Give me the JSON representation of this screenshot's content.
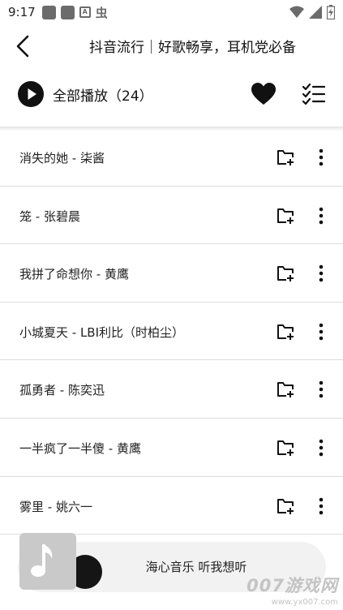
{
  "status_bar": {
    "time": "9:17",
    "icons": [
      "app-icon",
      "app-icon",
      "a-icon",
      "bug-icon",
      "wifi-icon",
      "signal-icon",
      "battery-icon"
    ]
  },
  "header": {
    "title": "抖音流行｜好歌畅享，耳机党必备"
  },
  "play_all": {
    "label": "全部播放（24）"
  },
  "songs": [
    {
      "title": "消失的她 - 柒酱"
    },
    {
      "title": "笼 - 张碧晨"
    },
    {
      "title": "我拼了命想你 - 黄鹰"
    },
    {
      "title": "小城夏天 - LBI利比（时柏尘）"
    },
    {
      "title": "孤勇者 - 陈奕迅"
    },
    {
      "title": "一半疯了一半傻 - 黄鹰"
    },
    {
      "title": "雾里 - 姚六一"
    }
  ],
  "mini_player": {
    "now_playing": "海心音乐 听我想听"
  },
  "watermark": {
    "main": "007游戏网",
    "sub": "www.yx007.com"
  },
  "colors": {
    "accent": "#111111",
    "divider": "#dcdcdc",
    "mini_bg": "#f2f2f2"
  }
}
